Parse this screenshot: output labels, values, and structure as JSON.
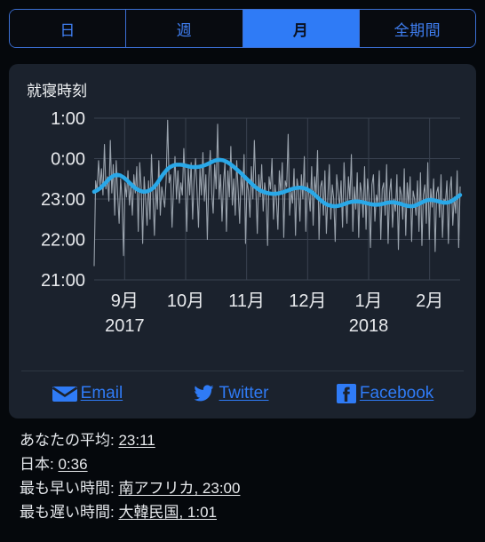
{
  "tabs": {
    "items": [
      {
        "label": "日",
        "active": false
      },
      {
        "label": "週",
        "active": false
      },
      {
        "label": "月",
        "active": true
      },
      {
        "label": "全期間",
        "active": false
      }
    ]
  },
  "card": {
    "title": "就寝時刻"
  },
  "share": {
    "items": [
      {
        "label": "Email",
        "icon": "envelope-icon"
      },
      {
        "label": "Twitter",
        "icon": "twitter-bird-icon"
      },
      {
        "label": "Facebook",
        "icon": "facebook-f-icon"
      }
    ]
  },
  "stats": {
    "rows": [
      {
        "label": "あなたの平均:",
        "value": "23:11"
      },
      {
        "label": "日本:",
        "value": "0:36"
      },
      {
        "label": "最も早い時間:",
        "value": "南アフリカ, 23:00"
      },
      {
        "label": "最も遅い時間:",
        "value": "大韓民国, 1:01"
      }
    ]
  },
  "colors": {
    "page_background": "#05080c",
    "card_background": "#1b222d",
    "accent_blue": "#2f7bf6",
    "trend_line": "#29a8e8",
    "raw_line": "#9aa3ad",
    "grid": "#3a4250",
    "text_primary": "#e8eaed"
  },
  "chart_data": {
    "type": "line",
    "title": "就寝時刻",
    "xlabel": "",
    "ylabel": "",
    "grid": true,
    "legend": false,
    "ylim": [
      21,
      25
    ],
    "ytick_values": [
      25,
      24,
      23,
      22,
      21
    ],
    "ytick_labels": [
      "1:00",
      "0:00",
      "23:00",
      "22:00",
      "21:00"
    ],
    "xtick_positions": [
      0.5,
      1.5,
      2.5,
      3.5,
      4.5,
      5.5
    ],
    "xtick_labels": [
      "9月",
      "10月",
      "11月",
      "12月",
      "1月",
      "2月"
    ],
    "xtick_sublabels": [
      "2017",
      "",
      "",
      "",
      "2018",
      ""
    ],
    "xlim": [
      0,
      6
    ],
    "series": [
      {
        "name": "raw",
        "color": "#9aa3ad",
        "values": [
          21.35,
          23.45,
          23.2,
          23.95,
          23.3,
          23.75,
          23.1,
          24.35,
          23.25,
          23.55,
          22.95,
          24.45,
          23.15,
          23.85,
          22.6,
          23.95,
          23.1,
          22.4,
          23.5,
          23.0,
          21.6,
          23.4,
          23.05,
          23.7,
          22.85,
          23.35,
          22.6,
          23.6,
          23.15,
          23.8,
          22.2,
          23.9,
          23.3,
          21.9,
          23.55,
          23.0,
          22.35,
          23.45,
          22.5,
          24.1,
          23.1,
          22.1,
          23.35,
          22.75,
          23.95,
          22.6,
          23.3,
          23.05,
          22.8,
          23.5,
          24.95,
          23.4,
          23.6,
          22.3,
          23.25,
          24.05,
          23.0,
          23.7,
          22.9,
          23.4,
          23.1,
          24.25,
          23.35,
          22.2,
          23.8,
          23.1,
          23.9,
          22.5,
          23.45,
          24.0,
          23.2,
          22.3,
          23.75,
          23.1,
          24.15,
          22.95,
          23.6,
          22.0,
          23.5,
          24.2,
          23.15,
          22.65,
          23.85,
          23.25,
          24.85,
          23.0,
          23.6,
          22.45,
          23.4,
          23.9,
          22.2,
          23.7,
          23.05,
          24.3,
          22.85,
          23.5,
          22.6,
          23.95,
          23.2,
          22.4,
          23.65,
          23.1,
          24.1,
          21.9,
          23.45,
          23.2,
          22.55,
          23.8,
          23.0,
          24.45,
          23.3,
          22.15,
          23.6,
          23.05,
          23.85,
          22.7,
          23.4,
          23.1,
          21.85,
          23.55,
          23.25,
          24.0,
          22.5,
          23.35,
          23.0,
          22.25,
          23.7,
          23.15,
          23.9,
          22.05,
          23.45,
          23.3,
          24.6,
          22.6,
          23.2,
          22.9,
          23.75,
          22.1,
          23.5,
          23.25,
          22.45,
          23.6,
          23.0,
          24.05,
          22.2,
          23.4,
          23.15,
          22.7,
          23.8,
          22.35,
          23.55,
          23.1,
          24.2,
          22.0,
          23.3,
          23.45,
          22.6,
          23.7,
          22.15,
          23.05,
          23.85,
          22.5,
          23.35,
          23.0,
          21.95,
          23.6,
          23.2,
          22.8,
          23.45,
          22.3,
          23.9,
          23.1,
          22.4,
          23.55,
          23.0,
          24.1,
          22.2,
          23.3,
          22.75,
          23.65,
          22.05,
          23.4,
          23.15,
          22.55,
          23.8,
          22.25,
          23.5,
          23.05,
          21.8,
          23.35,
          23.6,
          22.45,
          23.1,
          22.9,
          23.7,
          22.0,
          23.25,
          23.4,
          22.6,
          23.85,
          21.9,
          23.15,
          23.5,
          22.3,
          23.0,
          22.7,
          23.6,
          21.75,
          23.3,
          23.1,
          22.5,
          23.75,
          22.1,
          23.4,
          22.85,
          23.55,
          21.95,
          23.2,
          23.0,
          22.6,
          23.45,
          22.2,
          23.65,
          21.85,
          23.1,
          23.35,
          22.4,
          23.9,
          22.0,
          23.25,
          22.8,
          23.5,
          21.7,
          23.15,
          23.3,
          22.55,
          23.6,
          22.05,
          23.0,
          22.9,
          23.45,
          21.9,
          23.2,
          23.55,
          22.35,
          23.05,
          22.65,
          23.7,
          21.8,
          23.3
        ]
      },
      {
        "name": "trend",
        "color": "#29a8e8",
        "values": [
          23.18,
          23.22,
          23.28,
          23.36,
          23.45,
          23.53,
          23.58,
          23.6,
          23.58,
          23.53,
          23.46,
          23.38,
          23.3,
          23.24,
          23.2,
          23.18,
          23.19,
          23.22,
          23.28,
          23.38,
          23.5,
          23.62,
          23.72,
          23.79,
          23.83,
          23.85,
          23.85,
          23.84,
          23.82,
          23.8,
          23.79,
          23.79,
          23.8,
          23.82,
          23.85,
          23.89,
          23.93,
          23.96,
          23.97,
          23.96,
          23.93,
          23.88,
          23.82,
          23.75,
          23.68,
          23.6,
          23.52,
          23.44,
          23.36,
          23.29,
          23.23,
          23.19,
          23.16,
          23.14,
          23.13,
          23.13,
          23.14,
          23.16,
          23.19,
          23.22,
          23.25,
          23.27,
          23.28,
          23.28,
          23.26,
          23.22,
          23.17,
          23.1,
          23.02,
          22.95,
          22.89,
          22.85,
          22.83,
          22.82,
          22.83,
          22.85,
          22.88,
          22.91,
          22.93,
          22.94,
          22.94,
          22.93,
          22.91,
          22.89,
          22.87,
          22.86,
          22.86,
          22.87,
          22.89,
          22.91,
          22.92,
          22.92,
          22.9,
          22.88,
          22.85,
          22.83,
          22.82,
          22.83,
          22.86,
          22.9,
          22.94,
          22.97,
          22.98,
          22.97,
          22.95,
          22.93,
          22.91,
          22.91,
          22.93,
          22.98,
          23.04,
          23.1
        ]
      }
    ]
  }
}
